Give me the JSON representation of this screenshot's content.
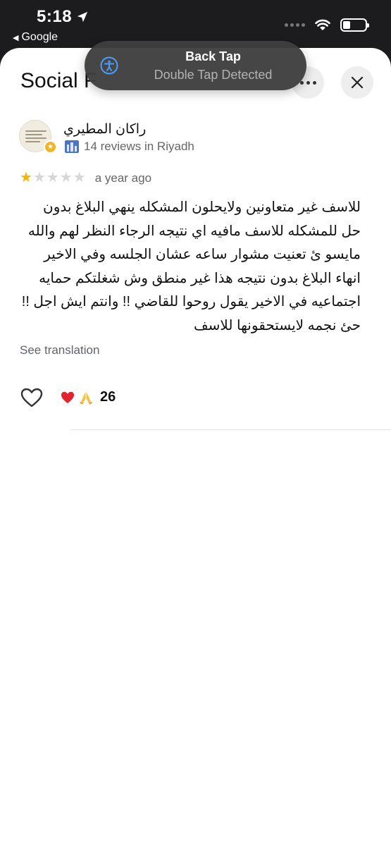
{
  "status_bar": {
    "time": "5:18",
    "back_app": "Google",
    "icons": [
      "location-arrow-icon",
      "wifi-icon",
      "battery-icon"
    ]
  },
  "toast": {
    "title": "Back Tap",
    "subtitle": "Double Tap Detected",
    "icon": "accessibility-icon"
  },
  "sheet": {
    "title": "Social F",
    "more_icon": "more-icon",
    "close_icon": "close-icon"
  },
  "review": {
    "reviewer": "راكان المطيري",
    "reviewer_meta": "14 reviews in Riyadh",
    "rating": 1,
    "rating_max": 5,
    "time_ago": "a year ago",
    "text": "للاسف غير متعاونين ولايحلون المشكله ينهي البلاغ بدون حل للمشكله للاسف مافيه اي نتيجه الرجاء النظر لهم والله مايسو ئ  تعنيت مشوار ساعه عشان الجلسه وفي الاخير انهاء البلاغ بدون نتيجه هذا غير منطق وش شغلتكم حمايه اجتماعيه في الاخير يقول روحوا للقاضي !! وانتم ايش اجل !!حئ نجمه لايستحقونها للاسف",
    "see_translation": "See translation",
    "reactions": [
      "red-heart-emoji",
      "folded-hands-emoji"
    ],
    "reaction_count": "26"
  },
  "colors": {
    "star_filled": "#f6b400",
    "star_empty": "#d6d6d6",
    "toast_bg": "#3e3e40",
    "sheet_bg": "#ffffff"
  }
}
